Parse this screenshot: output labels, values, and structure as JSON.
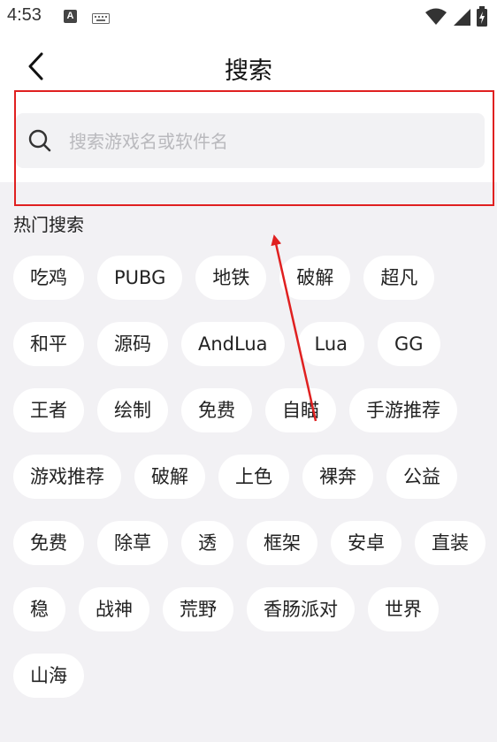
{
  "status_bar": {
    "time": "4:53",
    "notification_letter": "A",
    "icons": [
      "a-notification-icon",
      "keyboard-icon",
      "wifi-icon",
      "signal-icon",
      "battery-icon"
    ]
  },
  "header": {
    "title": "搜索",
    "back_icon": "chevron-left-icon"
  },
  "search": {
    "placeholder": "搜索游戏名或软件名",
    "value": "",
    "icon": "search-icon"
  },
  "hot_search": {
    "title": "热门搜索",
    "tags": [
      "吃鸡",
      "PUBG",
      "地铁",
      "破解",
      "超凡",
      "和平",
      "源码",
      "AndLua",
      "Lua",
      "GG",
      "王者",
      "绘制",
      "免费",
      "自瞄",
      "手游推荐",
      "游戏推荐",
      "破解",
      "上色",
      "裸奔",
      "公益",
      "免费",
      "除草",
      "透",
      "框架",
      "安卓",
      "直装",
      "稳",
      "战神",
      "荒野",
      "香肠派对",
      "世界",
      "山海"
    ]
  },
  "annotation": {
    "highlight_color": "#e02020",
    "arrow_color": "#e02020"
  },
  "colors": {
    "background": "#f2f1f4",
    "surface": "#ffffff",
    "search_box": "#f2f2f4",
    "placeholder": "#b9b9bd"
  }
}
